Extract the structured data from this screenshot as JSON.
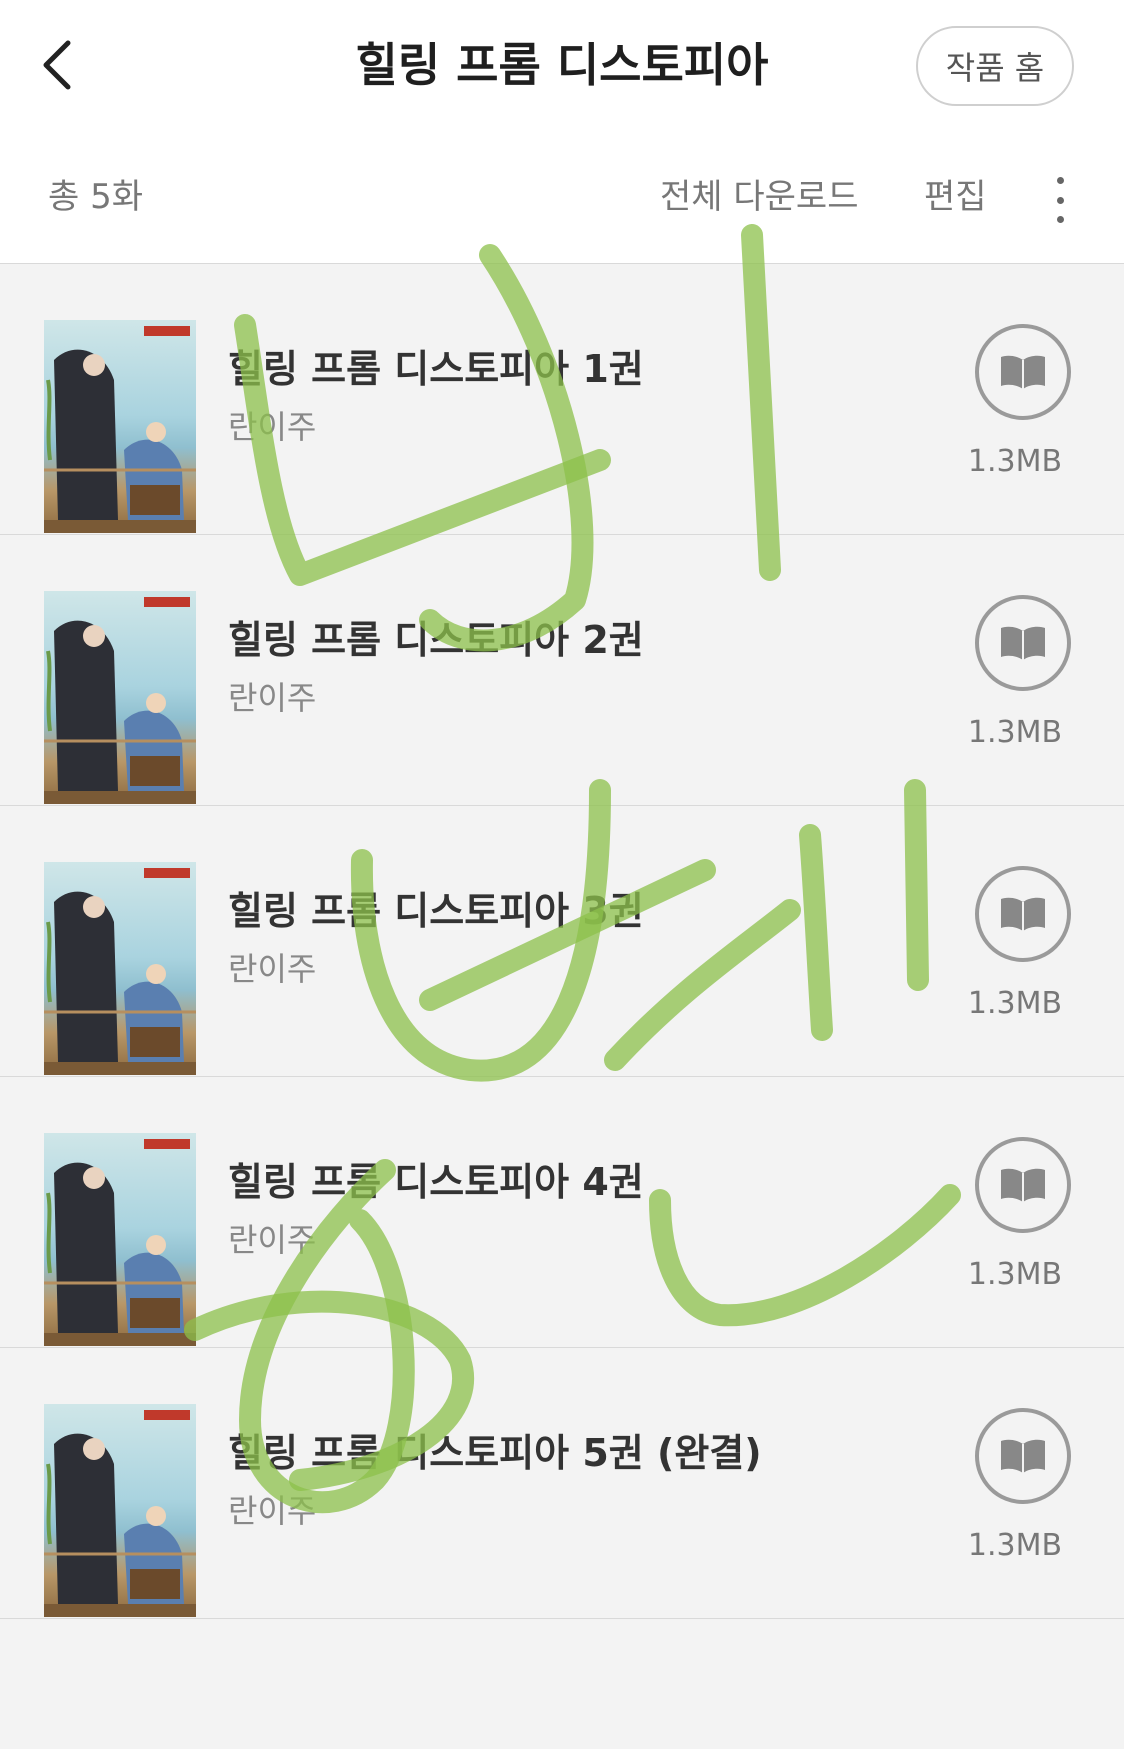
{
  "header": {
    "title": "힐링 프롬 디스토피아",
    "home_label": "작품 홈"
  },
  "toolbar": {
    "count": "총 5화",
    "download_all": "전체 다운로드",
    "edit": "편집"
  },
  "episodes": [
    {
      "title": "힐링 프롬 디스토피아 1권",
      "author": "란이주",
      "size": "1.3MB"
    },
    {
      "title": "힐링 프롬 디스토피아 2권",
      "author": "란이주",
      "size": "1.3MB"
    },
    {
      "title": "힐링 프롬 디스토피아 3권",
      "author": "란이주",
      "size": "1.3MB"
    },
    {
      "title": "힐링 프롬 디스토피아 4권",
      "author": "란이주",
      "size": "1.3MB"
    },
    {
      "title": "힐링 프롬 디스토피아 5권 (완결)",
      "author": "란이주",
      "size": "1.3MB"
    }
  ],
  "icons": {
    "back": "chevron-left-icon",
    "more": "more-vertical-icon",
    "read": "book-open-icon"
  },
  "colors": {
    "background": "#f3f3f3",
    "header_bg": "#ffffff",
    "doodle": "#8cc04b"
  }
}
